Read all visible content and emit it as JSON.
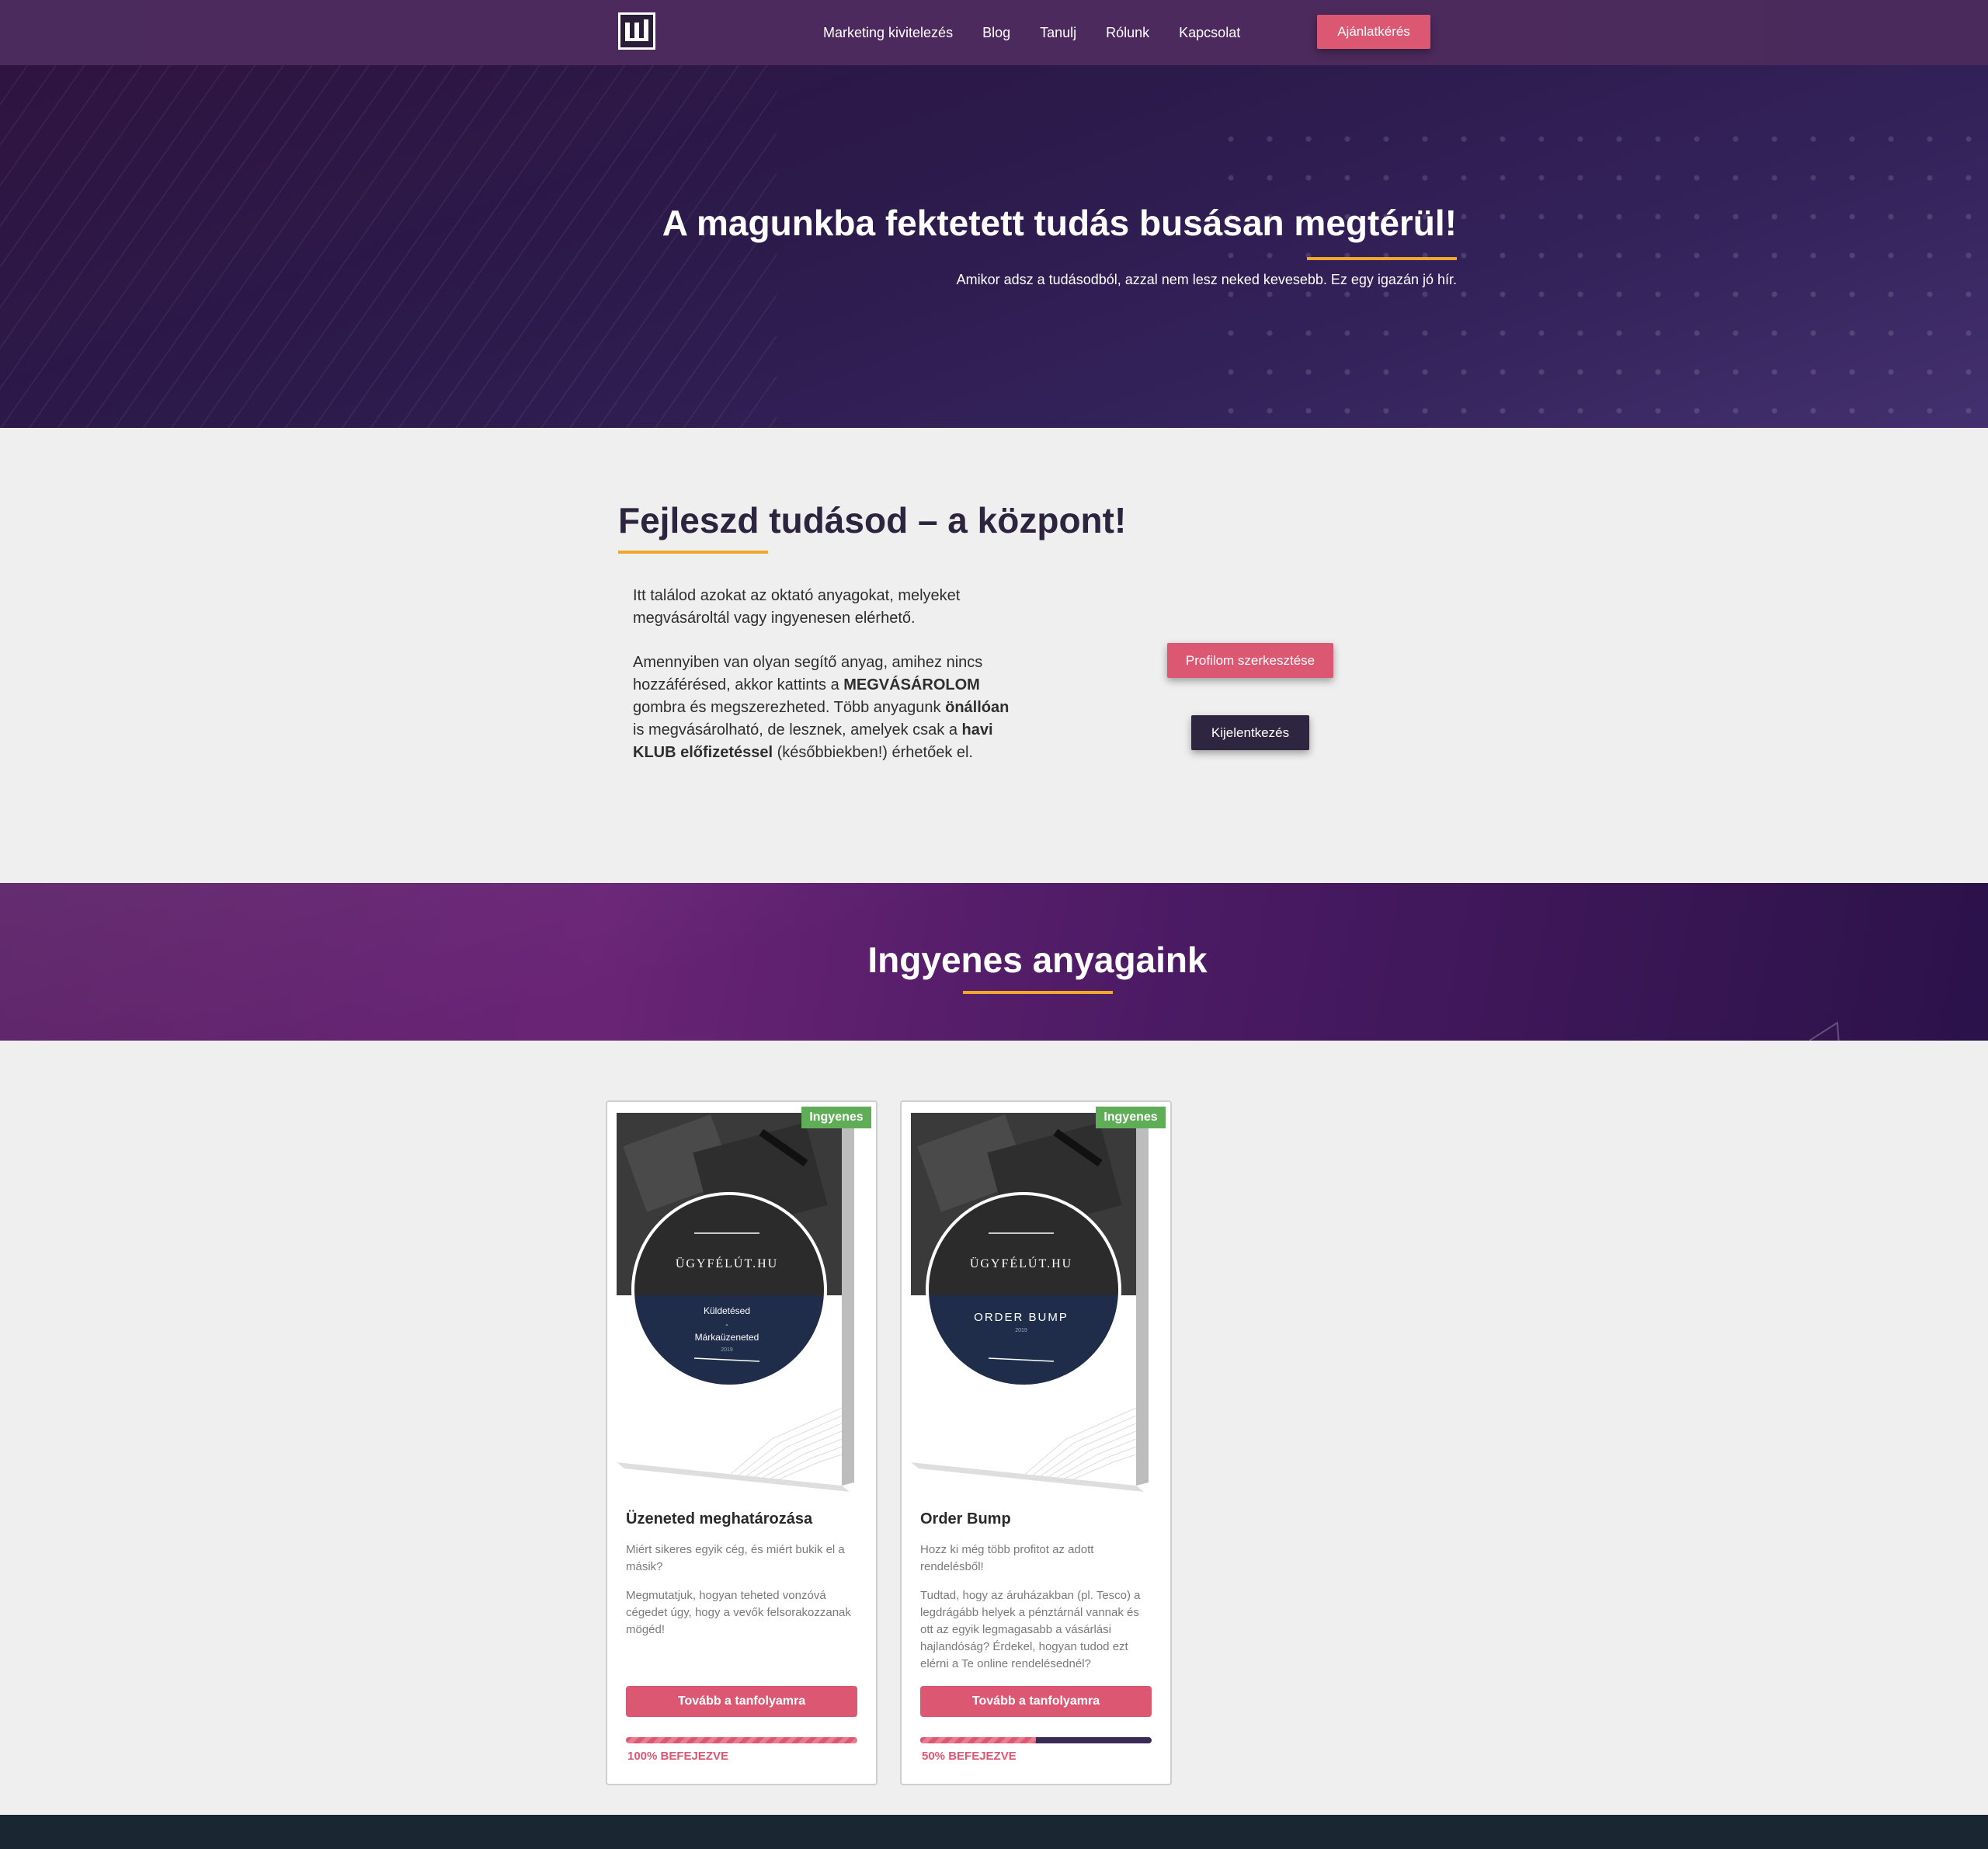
{
  "nav": {
    "links": [
      "Marketing kivitelezés",
      "Blog",
      "Tanulj",
      "Rólunk",
      "Kapcsolat"
    ],
    "cta": "Ajánlatkérés"
  },
  "hero": {
    "title": "A magunkba fektetett tudás busásan megtérül!",
    "subtitle": "Amikor adsz a tudásodból, azzal nem lesz neked kevesebb. Ez egy igazán jó hír."
  },
  "intro": {
    "title": "Fejleszd tudásod – a központ!",
    "p1": "Itt találod azokat az oktató anyagokat, melyeket megvásároltál vagy ingyenesen elérhető.",
    "p2_a": "Amennyiben van olyan segítő anyag, amihez nincs hozzáférésed, akkor kattints a ",
    "p2_b": "MEGVÁSÁROLOM",
    "p2_c": " gombra és megszerezheted. Több anyagunk ",
    "p2_d": "önállóan",
    "p2_e": " is megvásárolható, de lesznek, amelyek csak  a ",
    "p2_f": "havi KLUB előfizetéssel",
    "p2_g": " (későbbiekben!) érhetőek el.",
    "profile_button": "Profilom szerkesztése",
    "logout_button": "Kijelentkezés"
  },
  "free_section": {
    "title": "Ingyenes anyagaink"
  },
  "courses": [
    {
      "badge": "Ingyenes",
      "cover_brand": "ÜGYFÉLÚT.HU",
      "cover_line1": "Küldetésed",
      "cover_line2": "-",
      "cover_line3": "Márkaüzeneted",
      "cover_year": "2019",
      "title": "Üzeneted meghatározása",
      "desc1": "Miért sikeres egyik cég, és miért bukik el a másik?",
      "desc2": "Megmutatjuk, hogyan teheted vonzóvá cégedet úgy, hogy a vevők felsorakozzanak mögéd!",
      "button": "Tovább a tanfolyamra",
      "progress": 100,
      "progress_label": "100% BEFEJEZVE"
    },
    {
      "badge": "Ingyenes",
      "cover_brand": "ÜGYFÉLÚT.HU",
      "cover_line1": "ORDER BUMP",
      "cover_year": "2019",
      "title": "Order Bump",
      "desc1": "Hozz ki még több profitot az adott rendelésből!",
      "desc2": "Tudtad, hogy az áruházakban (pl. Tesco) a legdrágább helyek a pénztárnál vannak és ott az egyik legmagasabb a vásárlási hajlandóság? Érdekel, hogyan tudod ezt elérni a Te online rendelésednél?",
      "button": "Tovább a tanfolyamra",
      "progress": 50,
      "progress_label": "50% BEFEJEZVE"
    }
  ],
  "colors": {
    "accent_pink": "#dc5872",
    "accent_gold": "#f0a82c",
    "dark_purple": "#2e2540",
    "badge_green": "#5fae57"
  }
}
